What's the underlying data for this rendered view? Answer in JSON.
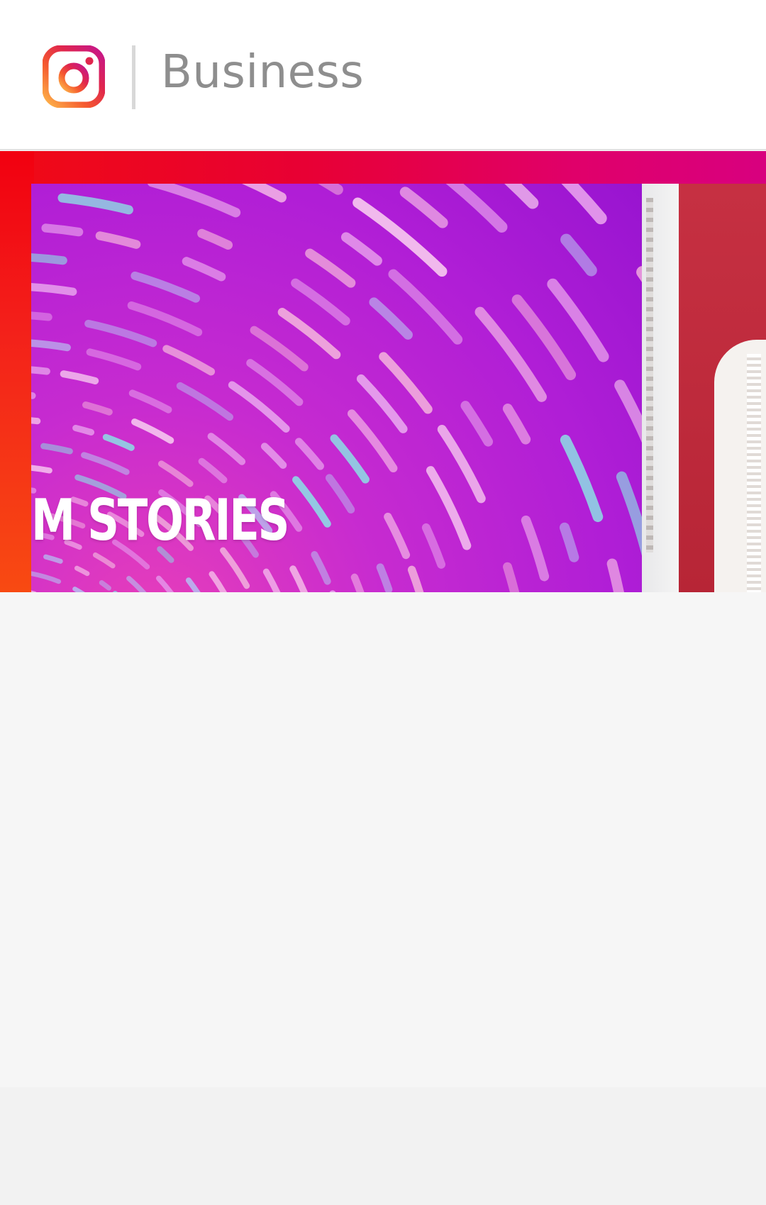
{
  "header": {
    "logo_icon": "instagram-logo-icon",
    "brand_label": "Business"
  },
  "carousel": {
    "slides": [
      {
        "title": "M STORIES",
        "image": "radial-light-streaks-image"
      },
      {
        "image": "person-in-white-blouse-image"
      }
    ]
  },
  "colors": {
    "brand_gradient": [
      "#f00a14",
      "#e0006a",
      "#d8007f"
    ],
    "slide_background": "#b01ed6",
    "page_background": "#f6f6f6"
  }
}
